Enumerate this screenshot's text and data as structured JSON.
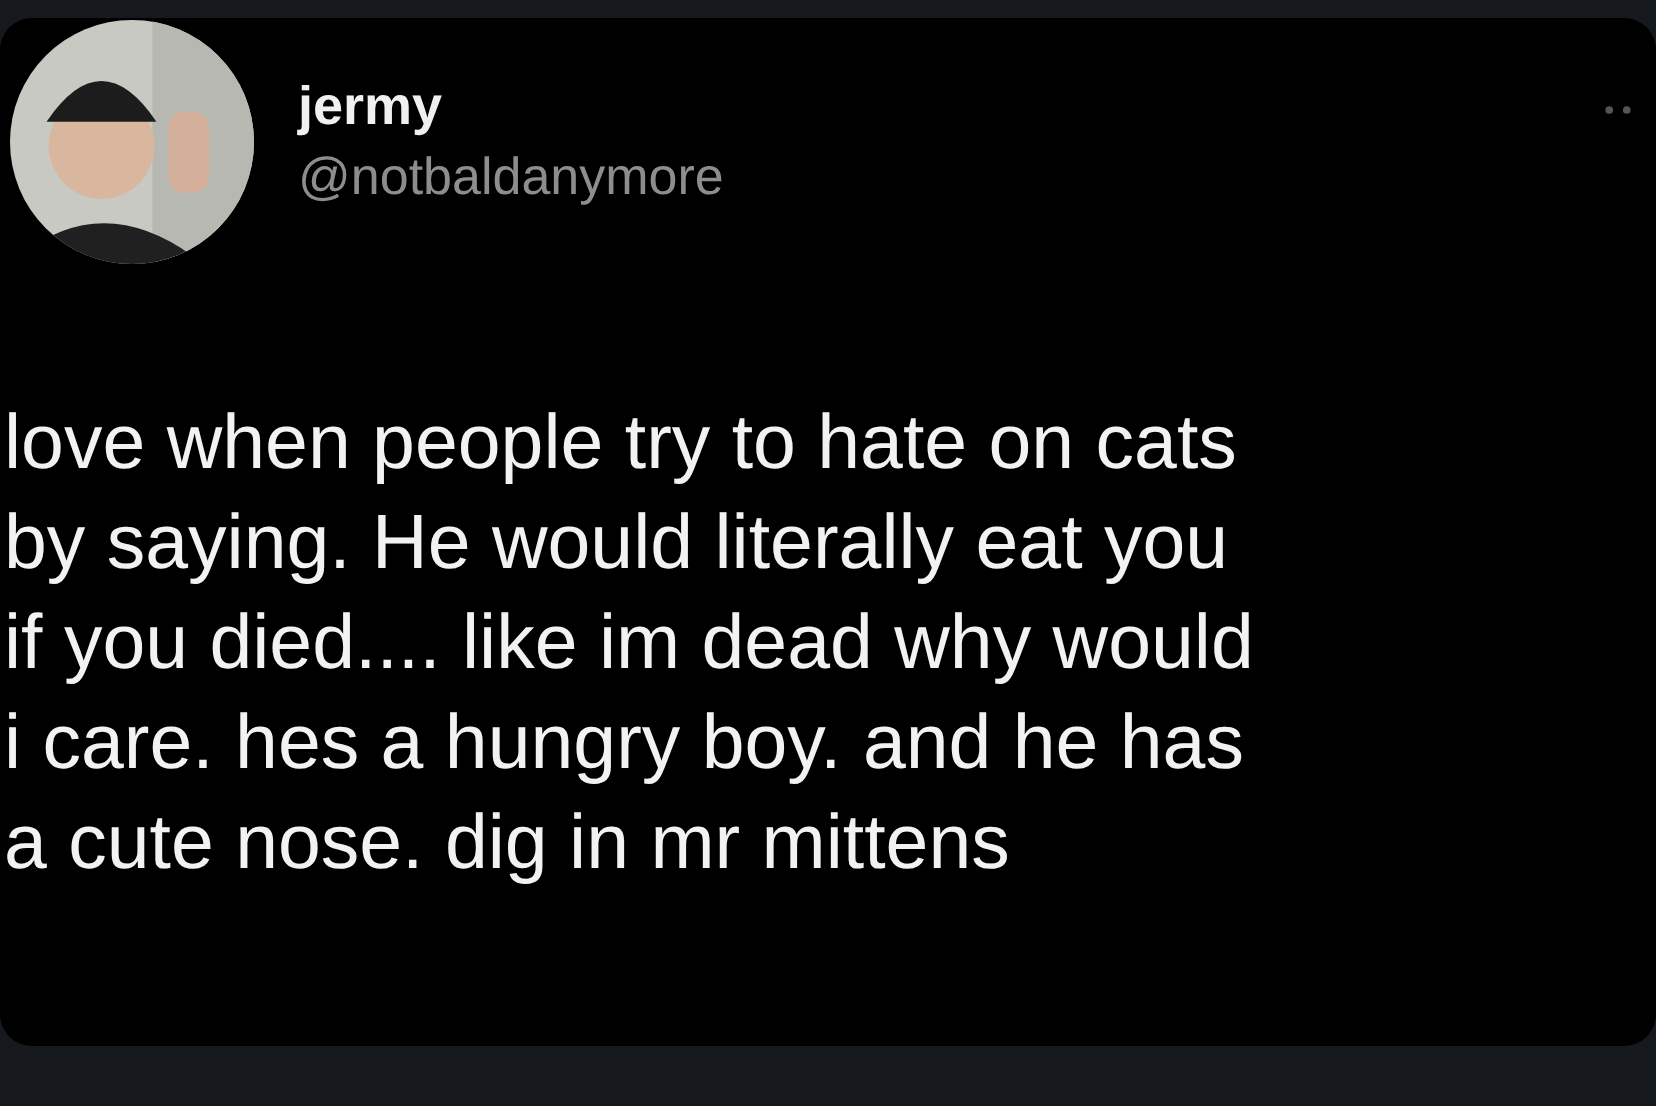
{
  "author": {
    "name": "jermy",
    "handle": "@notbaldanymore"
  },
  "text": "love when people try to hate on cats\nby saying. He would literally eat you\nif you died.... like im dead why would\ni care. hes a hungry boy. and he has\na cute nose. dig in mr mittens"
}
